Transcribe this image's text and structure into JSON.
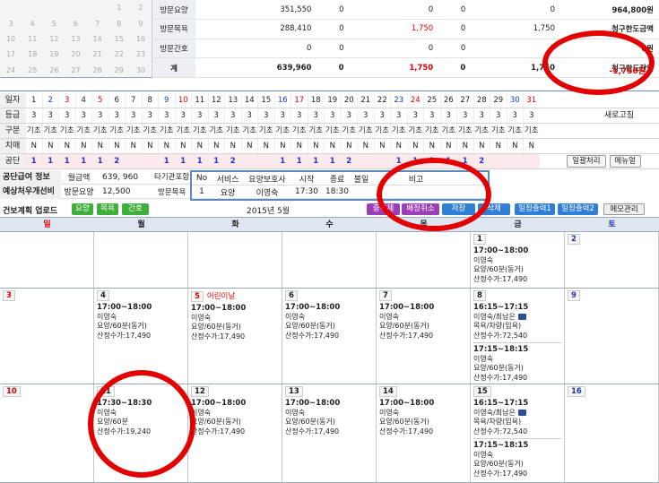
{
  "mini_calendar": [
    [
      "",
      "",
      "",
      "",
      "",
      "1",
      "2"
    ],
    [
      "3",
      "4",
      "5",
      "6",
      "7",
      "8",
      "9"
    ],
    [
      "10",
      "11",
      "12",
      "13",
      "14",
      "15",
      "16"
    ],
    [
      "17",
      "18",
      "19",
      "20",
      "21",
      "22",
      "23"
    ],
    [
      "24",
      "25",
      "26",
      "27",
      "28",
      "29",
      "30"
    ]
  ],
  "summary": [
    {
      "label": "방문요양",
      "c1": "351,550",
      "c2": "0",
      "c3": "0",
      "c4": "0",
      "c5": "0",
      "c6": "964,800원",
      "c6label": ""
    },
    {
      "label": "방문목욕",
      "c1": "288,410",
      "c2": "0",
      "c3": "1,750",
      "c4": "0",
      "c5": "1,750",
      "c6": "청구한도금액",
      "c6label": ""
    },
    {
      "label": "방문간호",
      "c1": "0",
      "c2": "0",
      "c3": "0",
      "c4": "0",
      "c5": "0",
      "c6": "0원",
      "c6label": ""
    },
    {
      "label": "계",
      "c1": "639,960",
      "c2": "0",
      "c3": "1,750",
      "c4": "0",
      "c5": "1,750",
      "c6": "청구한도잔액",
      "c6label": ""
    }
  ],
  "summary_remaining": "-1,750원",
  "grid": {
    "labels": [
      "일자",
      "등급",
      "구분",
      "치매",
      "공단"
    ],
    "days": [
      "1",
      "2",
      "3",
      "4",
      "5",
      "6",
      "7",
      "8",
      "9",
      "10",
      "11",
      "12",
      "13",
      "14",
      "15",
      "16",
      "17",
      "18",
      "19",
      "20",
      "21",
      "22",
      "23",
      "24",
      "25",
      "26",
      "27",
      "28",
      "29",
      "30",
      "31"
    ],
    "grade": [
      "3",
      "3",
      "3",
      "3",
      "3",
      "3",
      "3",
      "3",
      "3",
      "3",
      "3",
      "3",
      "3",
      "3",
      "3",
      "3",
      "3",
      "3",
      "3",
      "3",
      "3",
      "3",
      "3",
      "3",
      "3",
      "3",
      "3",
      "3",
      "3",
      "3",
      "3"
    ],
    "type": [
      "기초",
      "기초",
      "기초",
      "기초",
      "기초",
      "기초",
      "기초",
      "기초",
      "기초",
      "기초",
      "기초",
      "기초",
      "기초",
      "기초",
      "기초",
      "기초",
      "기초",
      "기초",
      "기초",
      "기초",
      "기초",
      "기초",
      "기초",
      "기초",
      "기초",
      "기초",
      "기초",
      "기초",
      "기초",
      "기초",
      "기초"
    ],
    "dementia": [
      "N",
      "N",
      "N",
      "N",
      "N",
      "N",
      "N",
      "N",
      "N",
      "N",
      "N",
      "N",
      "N",
      "N",
      "N",
      "N",
      "N",
      "N",
      "N",
      "N",
      "N",
      "N",
      "N",
      "N",
      "N",
      "N",
      "N",
      "N",
      "N",
      "N",
      "N"
    ],
    "gongdan": [
      "1",
      "1",
      "1",
      "1",
      "1",
      "2",
      "",
      "",
      "1",
      "1",
      "1",
      "1",
      "2",
      "",
      "",
      "1",
      "1",
      "1",
      "1",
      "2",
      "",
      "",
      "1",
      "1",
      "1",
      "1",
      "1",
      "2",
      "",
      "",
      ""
    ],
    "refresh": "새로고침",
    "batch": "일괄처리",
    "manual": "메뉴얼"
  },
  "info": {
    "row1_k": "공단급여 정보",
    "row1_k2": "월금액",
    "row1_v": "639, 960",
    "row1_x": "타기관포함",
    "row2_k": "예상처우개선비",
    "row2_k2": "방문요양",
    "row2_v": "12,500",
    "row2_x": "방문목욕"
  },
  "popup": {
    "headers": [
      "No",
      "서비스",
      "요양보호사",
      "시작",
      "종료",
      "불일",
      "비고"
    ],
    "row": [
      "1",
      "요양",
      "이영숙",
      "17:30",
      "18:30",
      "",
      ""
    ]
  },
  "toolbar": {
    "title": "건보계획 업로드",
    "yoyang": "요양",
    "mokyok": "목욕",
    "ganho": "간호",
    "month": "2015년 5월",
    "jung": "중복제",
    "cancel": "배정취소",
    "save": "저장",
    "del": "삭제",
    "print1": "일정출력1",
    "print2": "일정출력2",
    "memo": "메모관리"
  },
  "weekdays": [
    "일",
    "월",
    "화",
    "수",
    "목",
    "금",
    "토"
  ],
  "week1": {
    "fri": "1",
    "sat": "2",
    "fri_ev": {
      "t": "17:00~18:00",
      "n": "이영숙",
      "s": "요양/60분(동거)",
      "p": "산정수가:17,490"
    }
  },
  "week2": {
    "sun": "3",
    "mon": "4",
    "tue": "5",
    "holiday": "어린이날",
    "wed": "6",
    "thu": "7",
    "fri": "8",
    "sat": "9",
    "ev": {
      "t": "17:00~18:00",
      "n": "이영숙",
      "s": "요양/60분(동거)",
      "p": "산정수가:17,490"
    },
    "fri_ev1": {
      "t": "16:15~17:15",
      "n": "이영숙/최남은",
      "s": "목욕/차량(입욕)",
      "p": "산정수가:72,540"
    },
    "fri_ev2": {
      "t": "17:15~18:15",
      "n": "이영숙",
      "s": "요양/60분(동거)",
      "p": "산정수가:17,490"
    }
  },
  "week3": {
    "sun": "10",
    "mon": "11",
    "tue": "12",
    "wed": "13",
    "thu": "14",
    "fri": "15",
    "sat": "16",
    "mon_ev": {
      "t": "17:30~18:30",
      "n": "이영숙",
      "s": "요양/60분",
      "p": "산정수가:19,240"
    },
    "ev": {
      "t": "17:00~18:00",
      "n": "이영숙",
      "s": "요양/60분(동거)",
      "p": "산정수가:17,490"
    },
    "fri_ev1": {
      "t": "16:15~17:15",
      "n": "이영숙/최남은",
      "s": "목욕/차량(입욕)",
      "p": "산정수가:72,540"
    },
    "fri_ev2": {
      "t": "17:15~18:15",
      "n": "이영숙",
      "s": "요양/60분(동거)",
      "p": "산정수가:17,490"
    }
  },
  "colors": {
    "annotation": "#e30000",
    "save_btn": "#2f7fd6",
    "cancel_btn": "#9b3fb8",
    "green_btn": "#3fae3a"
  }
}
